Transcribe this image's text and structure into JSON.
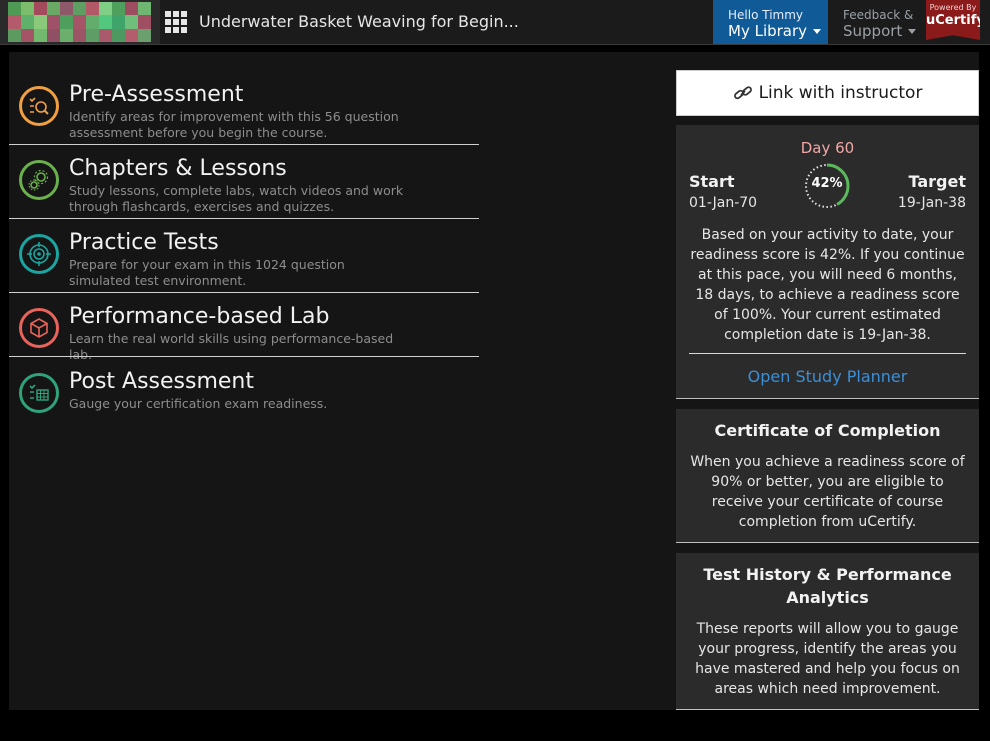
{
  "header": {
    "course_title": "Underwater Basket Weaving for Begin...",
    "greeting": "Hello Timmy",
    "library_label": "My Library",
    "feedback_top": "Feedback &",
    "feedback_bottom": "Support",
    "powered_by": "Powered By",
    "brand": "uCertify"
  },
  "menu": {
    "items": [
      {
        "title": "Pre-Assessment",
        "desc": "Identify areas for improvement with this 56 question assessment before you begin the course.",
        "icon": "pre-assessment-icon",
        "color": "#f0a040"
      },
      {
        "title": "Chapters & Lessons",
        "desc": "Study lessons, complete labs, watch videos and work through flashcards, exercises and quizzes.",
        "icon": "chapters-gear-icon",
        "color": "#6ab04c"
      },
      {
        "title": "Practice Tests",
        "desc": "Prepare for your exam in this 1024 question simulated test environment.",
        "icon": "target-icon",
        "color": "#1aa5a0"
      },
      {
        "title": "Performance-based Lab",
        "desc": "Learn the real world skills using performance-based lab.",
        "icon": "cube-icon",
        "color": "#e8645a"
      },
      {
        "title": "Post Assessment",
        "desc": "Gauge your certification exam readiness.",
        "icon": "post-assessment-icon",
        "color": "#2fa37a"
      }
    ]
  },
  "instructor_link": "Link with instructor",
  "readiness": {
    "day_label": "Day 60",
    "start_label": "Start",
    "start_date": "01-Jan-70",
    "target_label": "Target",
    "target_date": "19-Jan-38",
    "score_text": "42%",
    "score_value": 42,
    "description": "Based on your activity to date, your readiness score is 42%. If you continue at this pace, you will need 6 months, 18 days, to achieve a readiness score of 100%. Your current estimated completion date is 19-Jan-38.",
    "planner_link": "Open Study Planner"
  },
  "certificate": {
    "title": "Certificate of Completion",
    "body": "When you achieve a readiness score of 90% or better, you are eligible to receive your certificate of course completion from uCertify."
  },
  "analytics": {
    "title": "Test History & Performance Analytics",
    "body": "These reports will allow you to gauge your progress, identify the areas you have mastered and help you focus on areas which need improvement."
  },
  "colors": {
    "accent_blue": "#0f5a97",
    "link_blue": "#3b8fd6",
    "gauge_green": "#5cb85c",
    "brand_red": "#8b1a1a"
  }
}
